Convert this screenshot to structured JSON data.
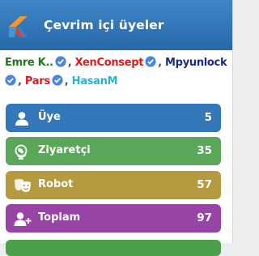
{
  "header": {
    "title": "Çevrim içi üyeler"
  },
  "colors": {
    "header": "#2f73b6",
    "verified_badge": "#4a86dc",
    "members": "#3378b8",
    "visitors": "#5aa75a",
    "robots": "#b59a3f",
    "total": "#9844a6"
  },
  "online_users": [
    {
      "name": "Emre K..",
      "color": "#1e7a1e",
      "verified": true
    },
    {
      "name": "XenConsept",
      "color": "#e01b1b",
      "verified": true
    },
    {
      "name": "Mpyunlock",
      "color": "#1c2a8a",
      "verified": false
    },
    {
      "name": "Pars",
      "color": "#e01b1b",
      "verified": true
    },
    {
      "name": "HasanM",
      "color": "#2ab3d0",
      "verified": true
    }
  ],
  "stats": [
    {
      "label": "Üye",
      "count": "5",
      "icon": "user-icon",
      "color": "#3378b8"
    },
    {
      "label": "Ziyaretçi",
      "count": "35",
      "icon": "globe-icon",
      "color": "#5aa75a"
    },
    {
      "label": "Robot",
      "count": "57",
      "icon": "mask-icon",
      "color": "#b59a3f"
    },
    {
      "label": "Toplam",
      "count": "97",
      "icon": "user-plus-icon",
      "color": "#9844a6"
    }
  ]
}
